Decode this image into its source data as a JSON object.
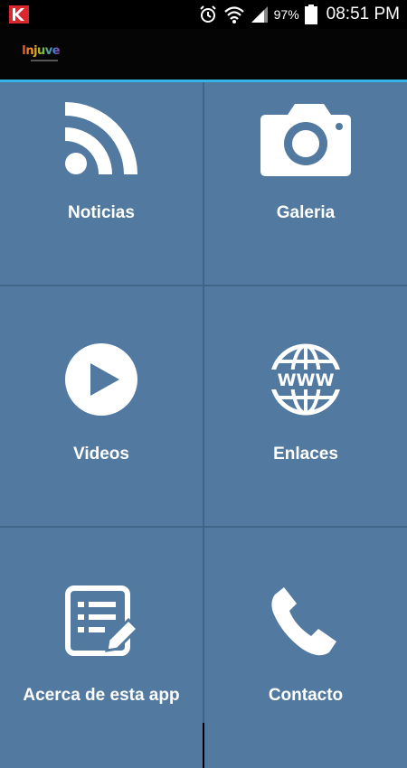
{
  "status_bar": {
    "battery_percent": "97%",
    "time": "08:51 PM",
    "icons": [
      "kaspersky-icon",
      "alarm-icon",
      "wifi-icon",
      "signal-icon",
      "battery-icon"
    ]
  },
  "action_bar": {
    "logo_text": "Injuve"
  },
  "colors": {
    "tile_bg": "#52799f",
    "divider": "#3f6589",
    "accent": "#33b5e5"
  },
  "menu": {
    "noticias": "Noticias",
    "galeria": "Galeria",
    "videos": "Videos",
    "enlaces": "Enlaces",
    "acerca": "Acerca de esta app",
    "contacto": "Contacto"
  }
}
